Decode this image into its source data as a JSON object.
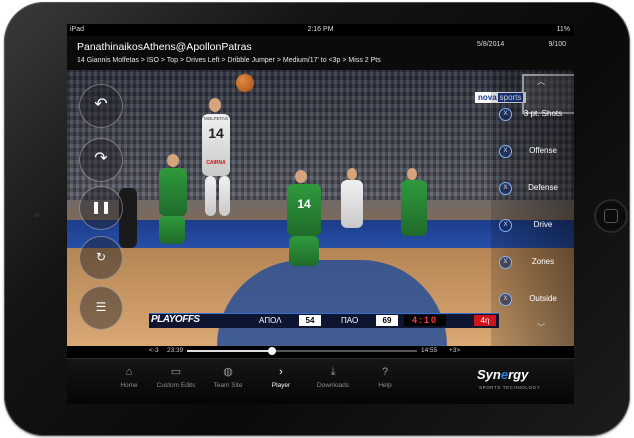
{
  "status_bar": {
    "device": "iPad",
    "time": "2:16 PM",
    "battery": "11%"
  },
  "header": {
    "title": "PanathinaikosAthens@ApollonPatras",
    "date": "5/8/2014",
    "counter": "9/100",
    "breadcrumb": "14 Giannis Molfetas > ISO > Top > Drives Left > Dribble Jumper > Medium/17' to <3p > Miss 2 Pts"
  },
  "overlay": {
    "tv_logo_a": "nova",
    "tv_logo_b": "sports"
  },
  "filters": [
    {
      "label": "3 pt. Shots",
      "remove": "X"
    },
    {
      "label": "Offense",
      "remove": "X"
    },
    {
      "label": "Defense",
      "remove": "X"
    },
    {
      "label": "Drive",
      "remove": "X"
    },
    {
      "label": "Zones",
      "remove": "X"
    },
    {
      "label": "Outside",
      "remove": "X"
    }
  ],
  "scoreboard": {
    "playoffs": "PLAYOFFS",
    "team1": "ΑΠΟΛ",
    "score1": "54",
    "team2": "ΠΑΟ",
    "score2": "69",
    "clock": "4:10",
    "quarter": "4η"
  },
  "players": {
    "jersey": "14",
    "jersey_name": "MOLFETAS",
    "jersey_team": "CAIRNA",
    "green_jersey": "14"
  },
  "scrubber": {
    "back": "<-3",
    "elapsed": "23:39",
    "remaining": "14:55",
    "forward": "+3>",
    "progress": 0.37
  },
  "tabs": [
    {
      "label": "Home",
      "icon": "home-icon",
      "active": false
    },
    {
      "label": "Custom Edits",
      "icon": "film-icon",
      "active": false
    },
    {
      "label": "Team Site",
      "icon": "globe-icon",
      "active": false
    },
    {
      "label": "Player",
      "icon": "chevron-right-icon",
      "active": true
    },
    {
      "label": "Downloads",
      "icon": "download-icon",
      "active": false
    },
    {
      "label": "Help",
      "icon": "question-icon",
      "active": false
    }
  ],
  "brand": {
    "name_a": "Syn",
    "name_b": "e",
    "name_c": "rgy",
    "tagline": "SPORTS TECHNOLOGY"
  }
}
